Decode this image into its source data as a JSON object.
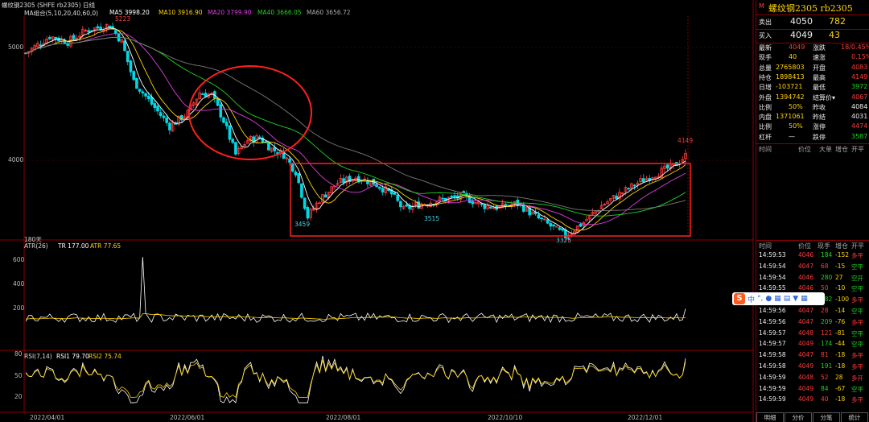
{
  "header": {
    "symbol": "螺纹钢2305 (SHFE rb2305)",
    "period": "日线",
    "ma_label": "MA组合(5,10,20,40,60,0)",
    "ma5": "MA5 3998.20",
    "ma10": "MA10 3916.90",
    "ma20": "MA20 3799.90",
    "ma40": "MA40 3666.05",
    "ma60": "MA60 3656.72"
  },
  "main_chart": {
    "y_ticks": [
      "5000",
      "4000"
    ],
    "annotations": {
      "high": "5223",
      "low1": "3459",
      "low2": "3515",
      "low3": "3325",
      "last_high": "4149"
    },
    "bars_label": "180天"
  },
  "atr": {
    "label": "ATR(26)",
    "tr": "TR 177.00",
    "atr": "ATR 77.65",
    "y_ticks": [
      "600",
      "400",
      "200"
    ]
  },
  "rsi": {
    "label": "RSI(7,14)",
    "rsi1": "RSI1 79.70",
    "rsi2": "RSI2 75.74",
    "y_ticks": [
      "80",
      "50",
      "20"
    ]
  },
  "x_ticks": [
    "2022/04/01",
    "2022/06/01",
    "2022/08/01",
    "2022/10/10",
    "2022/12/01"
  ],
  "quote": {
    "title": "螺纹钢2305 rb2305",
    "sell_label": "卖出",
    "sell_price": "4050",
    "sell_vol": "782",
    "buy_label": "买入",
    "buy_price": "4049",
    "buy_vol": "43",
    "rows": [
      {
        "l1": "最新",
        "v1": "4049",
        "c1": "red",
        "l2": "涨跌",
        "v2": "18/0.45%",
        "c2": "red"
      },
      {
        "l1": "现手",
        "v1": "40",
        "c1": "yellow",
        "l2": "速涨",
        "v2": "0.15%",
        "c2": "red"
      },
      {
        "l1": "总量",
        "v1": "2765803",
        "c1": "yellow",
        "l2": "开盘",
        "v2": "4083",
        "c2": "red"
      },
      {
        "l1": "持仓",
        "v1": "1898413",
        "c1": "yellow",
        "l2": "最高",
        "v2": "4149",
        "c2": "red"
      },
      {
        "l1": "日增",
        "v1": "-103721",
        "c1": "yellow",
        "l2": "最低",
        "v2": "3972",
        "c2": "green"
      },
      {
        "l1": "外盘",
        "v1": "1394742",
        "c1": "yellow",
        "l2": "结算价▾",
        "v2": "4067",
        "c2": "red"
      },
      {
        "l1": "比例",
        "v1": "50%",
        "c1": "yellow",
        "l2": "昨收",
        "v2": "4084",
        "c2": "white"
      },
      {
        "l1": "内盘",
        "v1": "1371061",
        "c1": "yellow",
        "l2": "昨结",
        "v2": "4031",
        "c2": "white"
      },
      {
        "l1": "比例",
        "v1": "50%",
        "c1": "yellow",
        "l2": "涨停",
        "v2": "4474",
        "c2": "red"
      },
      {
        "l1": "杠杆",
        "v1": "—",
        "c1": "white",
        "l2": "跌停",
        "v2": "3587",
        "c2": "green"
      }
    ],
    "mini_header": [
      "时间",
      "价位",
      "大单",
      "增仓",
      "开平"
    ],
    "tick_header": [
      "时间",
      "价位",
      "现手",
      "增仓",
      "开平"
    ],
    "ticks": [
      {
        "t": "14:59:53",
        "p": "4046",
        "v": "184",
        "d": "-152",
        "k": "多平"
      },
      {
        "t": "14:59:54",
        "p": "4047",
        "v": "68",
        "d": "-15",
        "k": "空平"
      },
      {
        "t": "14:59:54",
        "p": "4046",
        "v": "280",
        "d": "27",
        "k": "空开"
      },
      {
        "t": "14:59:55",
        "p": "4046",
        "v": "50",
        "d": "-10",
        "k": "空平"
      },
      {
        "t": "14:59:55",
        "p": "4047",
        "v": "182",
        "d": "-100",
        "k": "多平"
      },
      {
        "t": "14:59:56",
        "p": "4047",
        "v": "28",
        "d": "-14",
        "k": "空平"
      },
      {
        "t": "14:59:56",
        "p": "4047",
        "v": "209",
        "d": "-76",
        "k": "多平"
      },
      {
        "t": "14:59:57",
        "p": "4048",
        "v": "121",
        "d": "-81",
        "k": "空平"
      },
      {
        "t": "14:59:57",
        "p": "4049",
        "v": "174",
        "d": "-44",
        "k": "空平"
      },
      {
        "t": "14:59:58",
        "p": "4047",
        "v": "81",
        "d": "-18",
        "k": "多平"
      },
      {
        "t": "14:59:58",
        "p": "4049",
        "v": "191",
        "d": "-18",
        "k": "多平"
      },
      {
        "t": "14:59:59",
        "p": "4048",
        "v": "52",
        "d": "28",
        "k": "多开"
      },
      {
        "t": "14:59:59",
        "p": "4049",
        "v": "84",
        "d": "-67",
        "k": "空平"
      },
      {
        "t": "14:59:59",
        "p": "4049",
        "v": "40",
        "d": "-18",
        "k": "多平"
      }
    ],
    "tabs": [
      "明细",
      "分价",
      "分笔",
      "统计"
    ]
  },
  "colors": {
    "up": "#ff3b3b",
    "down": "#00d8e6",
    "grid": "#8b0000",
    "ma5": "#ffffff",
    "ma10": "#ffd400",
    "ma20": "#e03ce0",
    "ma40": "#21d421",
    "ma60": "#7a7a7a"
  }
}
